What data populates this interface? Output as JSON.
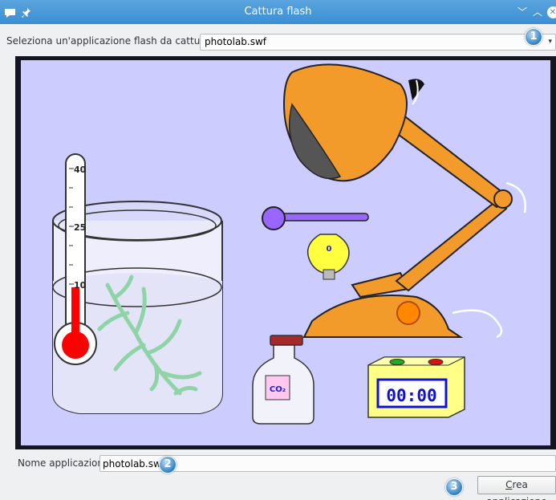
{
  "window": {
    "title": "Cattura flash",
    "minimize_glyph": "﹀",
    "maximize_glyph": "︿",
    "close_glyph": "✕"
  },
  "app_select": {
    "label": "Seleziona un'applicazione flash da catturare",
    "value": "photolab.swf",
    "badge": "1"
  },
  "flash_stage": {
    "thermometer_ticks": [
      "40",
      "25",
      "10"
    ],
    "bulb_value": "0",
    "co2_label": "CO₂",
    "timer_display": "00:00"
  },
  "app_name": {
    "label": "Nome applicazione",
    "value": "photolab.swf",
    "badge": "2"
  },
  "create_button": {
    "mnemonic": "C",
    "label_rest": "rea applicazione",
    "badge": "3"
  },
  "colors": {
    "titlebar": "#3a8fd4",
    "stage_bg": "#ccccff",
    "lamp": "#f39b2a",
    "mercury": "#ff0000",
    "plant": "#8fd4a7",
    "timer_digits": "#1010d0",
    "bulb": "#ffff40",
    "slider": "#9966ff"
  }
}
